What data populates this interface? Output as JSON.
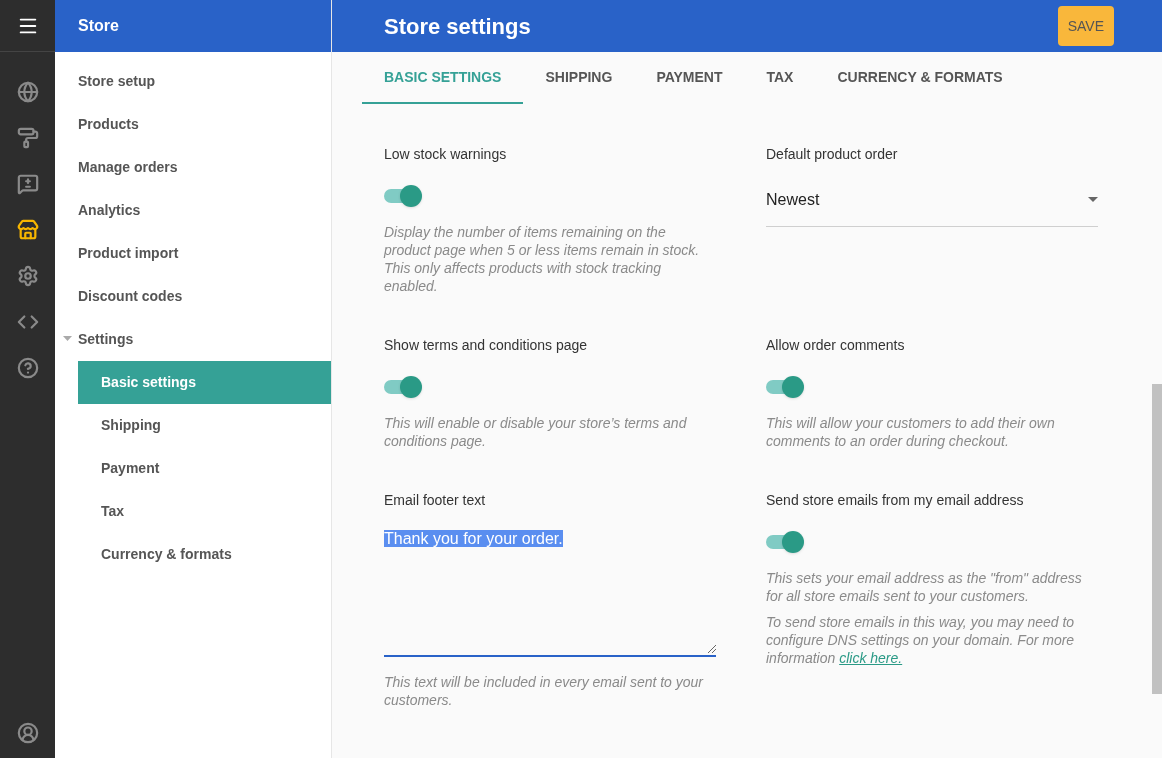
{
  "rail": [
    {
      "kind": "globe",
      "selected": false
    },
    {
      "kind": "roller",
      "selected": false
    },
    {
      "kind": "feedback",
      "selected": false
    },
    {
      "kind": "store",
      "selected": true
    },
    {
      "kind": "gear",
      "selected": false
    },
    {
      "kind": "code",
      "selected": false
    },
    {
      "kind": "help",
      "selected": false
    }
  ],
  "sidebar": {
    "title": "Store",
    "items": [
      {
        "label": "Store setup",
        "selected": false
      },
      {
        "label": "Products",
        "selected": false
      },
      {
        "label": "Manage orders",
        "selected": false
      },
      {
        "label": "Analytics",
        "selected": false
      },
      {
        "label": "Product import",
        "selected": false
      },
      {
        "label": "Discount codes",
        "selected": false
      },
      {
        "label": "Settings",
        "selected": false,
        "expanded": true,
        "children": [
          {
            "label": "Basic settings",
            "selected": true
          },
          {
            "label": "Shipping",
            "selected": false
          },
          {
            "label": "Payment",
            "selected": false
          },
          {
            "label": "Tax",
            "selected": false
          },
          {
            "label": "Currency & formats",
            "selected": false
          }
        ]
      }
    ]
  },
  "header": {
    "title": "Store settings",
    "save_button": "SAVE"
  },
  "tabs": [
    {
      "label": "BASIC SETTINGS",
      "selected": true
    },
    {
      "label": "SHIPPING",
      "selected": false
    },
    {
      "label": "PAYMENT",
      "selected": false
    },
    {
      "label": "TAX",
      "selected": false
    },
    {
      "label": "CURRENCY & FORMATS",
      "selected": false
    }
  ],
  "settings": [
    {
      "kind": "toggle",
      "label": "Low stock warnings",
      "on": true,
      "notes": [
        {
          "text": "Display the number of items remaining on the product page when 5 or less items remain in stock. This only affects products with stock tracking enabled."
        }
      ]
    },
    {
      "kind": "select",
      "label": "Default product order",
      "value": "Newest"
    },
    {
      "kind": "toggle",
      "label": "Show terms and conditions page",
      "on": true,
      "notes": [
        {
          "text": "This will enable or disable your store’s terms and conditions page."
        }
      ]
    },
    {
      "kind": "toggle",
      "label": "Allow order comments",
      "on": true,
      "notes": [
        {
          "text": "This will allow your customers to add their own comments to an order during checkout."
        }
      ]
    },
    {
      "kind": "textarea",
      "label": "Email footer text",
      "value": "Thank you for your order.",
      "text_selected": true,
      "notes": [
        {
          "text": "This text will be included in every email sent to your customers."
        }
      ]
    },
    {
      "kind": "toggle",
      "label": "Send store emails from my email address",
      "on": true,
      "notes": [
        {
          "text": "This sets your email address as the \"from\" address for all store emails sent to your customers."
        },
        {
          "text": "To send store emails in this way, you may need to configure DNS settings on your domain. For more information",
          "link": "click here."
        }
      ]
    }
  ]
}
